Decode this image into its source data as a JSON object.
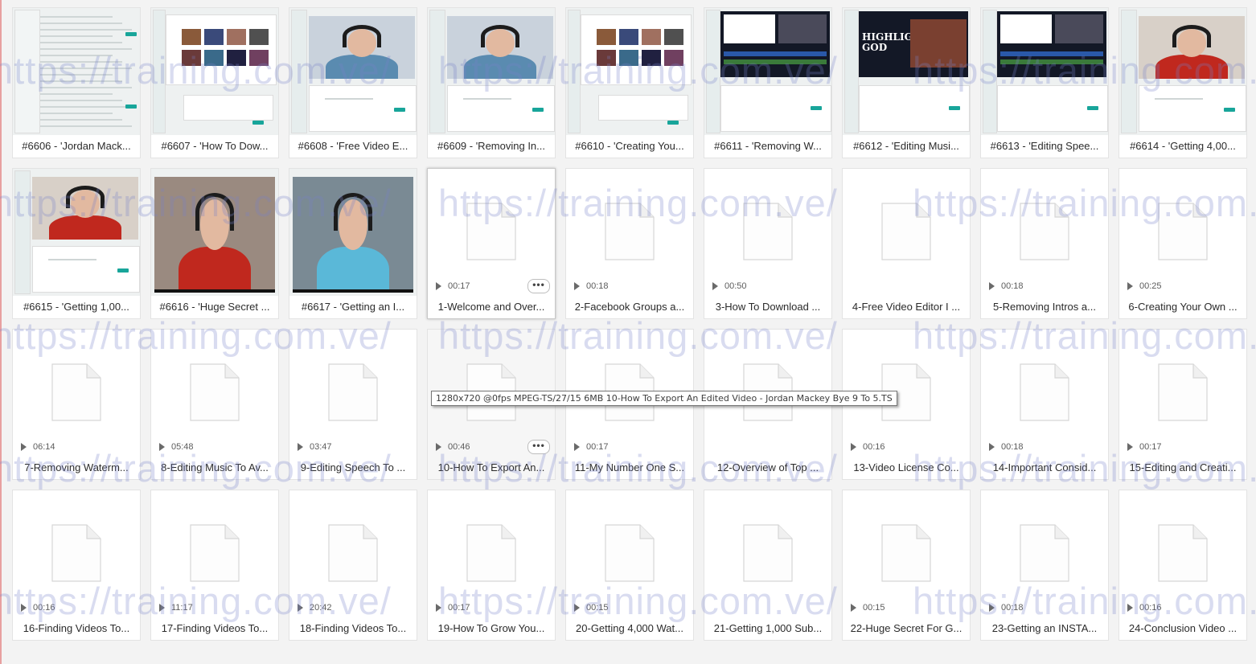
{
  "files": [
    {
      "name": "#6606 - 'Jordan Mack...",
      "kind": "screen"
    },
    {
      "name": "#6607 - 'How To Dow...",
      "kind": "screen-grid"
    },
    {
      "name": "#6608 - 'Free Video E...",
      "kind": "person-screen"
    },
    {
      "name": "#6609 - 'Removing In...",
      "kind": "person-screen"
    },
    {
      "name": "#6610 - 'Creating You...",
      "kind": "screen-grid"
    },
    {
      "name": "#6611 - 'Removing W...",
      "kind": "editor"
    },
    {
      "name": "#6612 - 'Editing Musi...",
      "kind": "highlight"
    },
    {
      "name": "#6613 - 'Editing Spee...",
      "kind": "editor"
    },
    {
      "name": "#6614 - 'Getting 4,00...",
      "kind": "person-red-screen"
    },
    {
      "name": "#6615 - 'Getting 1,00...",
      "kind": "person-red-screen"
    },
    {
      "name": "#6616 - 'Huge Secret ...",
      "kind": "person-red-full"
    },
    {
      "name": "#6617 - 'Getting an I...",
      "kind": "person-tank"
    },
    {
      "name": "1-Welcome and Over...",
      "duration": "00:17",
      "more": true,
      "selected": true
    },
    {
      "name": "2-Facebook Groups a...",
      "duration": "00:18"
    },
    {
      "name": "3-How To Download ...",
      "duration": "00:50"
    },
    {
      "name": "4-Free Video Editor I ...",
      "duration": ""
    },
    {
      "name": "5-Removing Intros a...",
      "duration": "00:18"
    },
    {
      "name": "6-Creating Your Own ...",
      "duration": "00:25"
    },
    {
      "name": "7-Removing Waterm...",
      "duration": "06:14"
    },
    {
      "name": "8-Editing Music To Av...",
      "duration": "05:48"
    },
    {
      "name": "9-Editing Speech To ...",
      "duration": "03:47"
    },
    {
      "name": "10-How To Export An...",
      "duration": "00:46",
      "more": true,
      "hovered": true
    },
    {
      "name": "11-My Number One S...",
      "duration": "00:17"
    },
    {
      "name": "12-Overview of Top ...",
      "duration": ""
    },
    {
      "name": "13-Video License Co...",
      "duration": "00:16"
    },
    {
      "name": "14-Important Consid...",
      "duration": "00:18"
    },
    {
      "name": "15-Editing and Creati...",
      "duration": "00:17"
    },
    {
      "name": "16-Finding Videos To...",
      "duration": "00:16"
    },
    {
      "name": "17-Finding Videos To...",
      "duration": "11:17"
    },
    {
      "name": "18-Finding Videos To...",
      "duration": "20:42"
    },
    {
      "name": "19-How To Grow You...",
      "duration": "00:17"
    },
    {
      "name": "20-Getting 4,000 Wat...",
      "duration": "00:15"
    },
    {
      "name": "21-Getting 1,000 Sub...",
      "duration": ""
    },
    {
      "name": "22-Huge Secret For G...",
      "duration": "00:15"
    },
    {
      "name": "23-Getting an INSTA...",
      "duration": "00:18"
    },
    {
      "name": "24-Conclusion Video ...",
      "duration": "00:16"
    }
  ],
  "tooltip": "1280x720 @0fps MPEG-TS/27/15 6MB 10-How To Export An Edited Video - Jordan Mackey Bye 9 To 5.TS",
  "watermark_text": "https://training.com.ve/",
  "thumb_text": {
    "highlight": "HIGHLIGHT\nGOD"
  },
  "colors": {
    "accent_teal": "#18a59a",
    "background": "#f3f3f3",
    "watermark": "#7882c8"
  }
}
